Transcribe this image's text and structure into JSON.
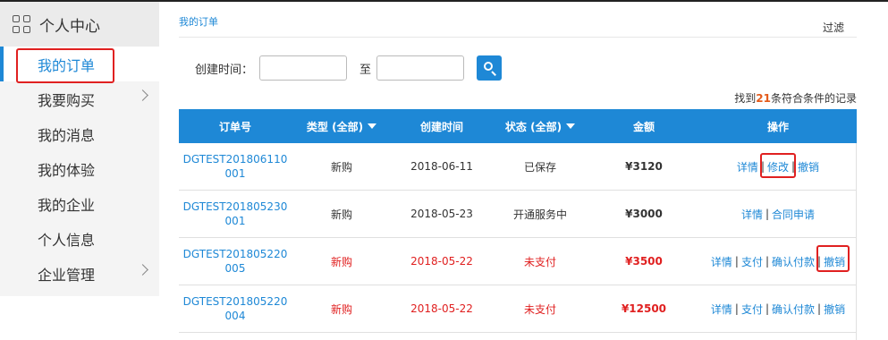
{
  "sidebar": {
    "title": "个人中心",
    "items": [
      {
        "label": "我的订单",
        "active": true,
        "has_arrow": false
      },
      {
        "label": "我要购买",
        "active": false,
        "has_arrow": true
      },
      {
        "label": "我的消息",
        "active": false,
        "has_arrow": false
      },
      {
        "label": "我的体验",
        "active": false,
        "has_arrow": false
      },
      {
        "label": "我的企业",
        "active": false,
        "has_arrow": false
      },
      {
        "label": "个人信息",
        "active": false,
        "has_arrow": false
      },
      {
        "label": "企业管理",
        "active": false,
        "has_arrow": true
      }
    ]
  },
  "header": {
    "breadcrumb": "我的订单",
    "filter_label": "过滤"
  },
  "search": {
    "label": "创建时间：",
    "to_label": "至",
    "start_value": "",
    "end_value": ""
  },
  "result": {
    "prefix": "找到",
    "count": "21",
    "suffix": "条符合条件的记录"
  },
  "table": {
    "headers": [
      "订单号",
      "类型 (全部)",
      "创建时间",
      "状态 (全部)",
      "金额",
      "操作"
    ],
    "rows": [
      {
        "order_line1": "DGTEST201806110",
        "order_line2": "001",
        "type": "新购",
        "date": "2018-06-11",
        "status": "已保存",
        "amount": "¥3120",
        "unpaid": false,
        "ops": [
          "详情",
          "修改",
          "撤销"
        ]
      },
      {
        "order_line1": "DGTEST201805230",
        "order_line2": "001",
        "type": "新购",
        "date": "2018-05-23",
        "status": "开通服务中",
        "amount": "¥3000",
        "unpaid": false,
        "ops": [
          "详情",
          "合同申请"
        ]
      },
      {
        "order_line1": "DGTEST201805220",
        "order_line2": "005",
        "type": "新购",
        "date": "2018-05-22",
        "status": "未支付",
        "amount": "¥3500",
        "unpaid": true,
        "ops": [
          "详情",
          "支付",
          "确认付款",
          "撤销"
        ]
      },
      {
        "order_line1": "DGTEST201805220",
        "order_line2": "004",
        "type": "新购",
        "date": "2018-05-22",
        "status": "未支付",
        "amount": "¥12500",
        "unpaid": true,
        "ops": [
          "详情",
          "支付",
          "确认付款",
          "撤销"
        ]
      }
    ]
  },
  "colors": {
    "accent": "#1e88d6",
    "highlight_box": "#e02020",
    "unpaid_text": "#e02020",
    "count": "#e45b1b"
  }
}
